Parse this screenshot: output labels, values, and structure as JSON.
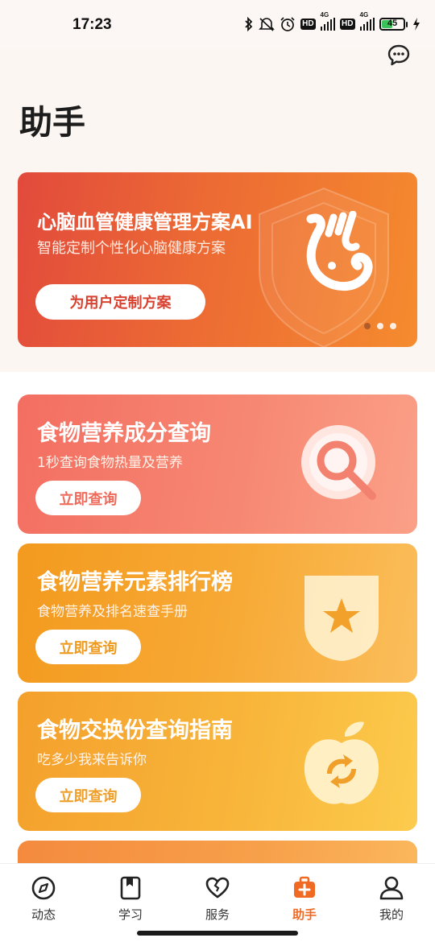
{
  "status_bar": {
    "time": "17:23",
    "hd_1": "HD",
    "hd_2": "HD",
    "network_1": "4G",
    "network_2": "4G",
    "battery_level": "45",
    "battery_fraction": 0.45
  },
  "header": {
    "title": "助手"
  },
  "banner": {
    "title": "心脑血管健康管理方案AI",
    "subtitle": "智能定制个性化心脑健康方案",
    "button_label": "为用户定制方案",
    "active_dot": 0,
    "dot_count": 3
  },
  "cards": [
    {
      "title": "食物营养成分查询",
      "subtitle": "1秒查询食物热量及营养",
      "button_label": "立即查询",
      "icon": "search-icon"
    },
    {
      "title": "食物营养元素排行榜",
      "subtitle": "食物营养及排名速查手册",
      "button_label": "立即查询",
      "icon": "star-shield-icon"
    },
    {
      "title": "食物交换份查询指南",
      "subtitle": "吃多少我来告诉你",
      "button_label": "立即查询",
      "icon": "apple-exchange-icon"
    }
  ],
  "tabbar": {
    "items": [
      {
        "label": "动态",
        "icon": "compass-icon"
      },
      {
        "label": "学习",
        "icon": "book-icon"
      },
      {
        "label": "服务",
        "icon": "heart-icon"
      },
      {
        "label": "助手",
        "icon": "medkit-icon",
        "active": true
      },
      {
        "label": "我的",
        "icon": "user-icon"
      }
    ]
  },
  "colors": {
    "accent": "#f06a24",
    "banner_start": "#e24a3c",
    "card1": "#f36e61",
    "card2": "#f39a1f",
    "card3": "#f4a02c"
  }
}
